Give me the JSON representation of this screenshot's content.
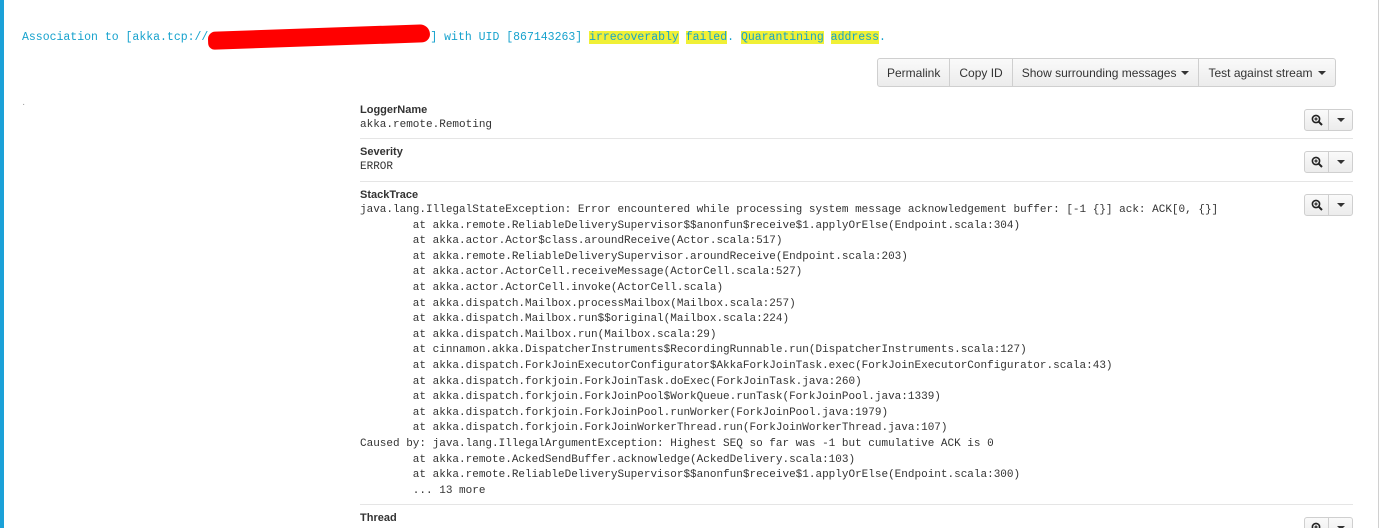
{
  "message": {
    "prefix": "Association to [akka.tcp://",
    "suffix_1": "] with UID [867143263] ",
    "hl_1": "irrecoverably",
    "hl_2": "failed",
    "dot_1": ". ",
    "hl_3": "Quarantining",
    "hl_4": "address",
    "dot_2": "."
  },
  "toolbar": {
    "permalink": "Permalink",
    "copy_id": "Copy ID",
    "show_surrounding": "Show surrounding messages",
    "test_against_stream": "Test against stream"
  },
  "left_marker": "·",
  "fields": [
    {
      "name": "LoggerName",
      "value": "akka.remote.Remoting"
    },
    {
      "name": "Severity",
      "value": "ERROR"
    },
    {
      "name": "StackTrace",
      "value": "java.lang.IllegalStateException: Error encountered while processing system message acknowledgement buffer: [-1 {}] ack: ACK[0, {}]\n        at akka.remote.ReliableDeliverySupervisor$$anonfun$receive$1.applyOrElse(Endpoint.scala:304)\n        at akka.actor.Actor$class.aroundReceive(Actor.scala:517)\n        at akka.remote.ReliableDeliverySupervisor.aroundReceive(Endpoint.scala:203)\n        at akka.actor.ActorCell.receiveMessage(ActorCell.scala:527)\n        at akka.actor.ActorCell.invoke(ActorCell.scala)\n        at akka.dispatch.Mailbox.processMailbox(Mailbox.scala:257)\n        at akka.dispatch.Mailbox.run$$original(Mailbox.scala:224)\n        at akka.dispatch.Mailbox.run(Mailbox.scala:29)\n        at cinnamon.akka.DispatcherInstruments$RecordingRunnable.run(DispatcherInstruments.scala:127)\n        at akka.dispatch.ForkJoinExecutorConfigurator$AkkaForkJoinTask.exec(ForkJoinExecutorConfigurator.scala:43)\n        at akka.dispatch.forkjoin.ForkJoinTask.doExec(ForkJoinTask.java:260)\n        at akka.dispatch.forkjoin.ForkJoinPool$WorkQueue.runTask(ForkJoinPool.java:1339)\n        at akka.dispatch.forkjoin.ForkJoinPool.runWorker(ForkJoinPool.java:1979)\n        at akka.dispatch.forkjoin.ForkJoinWorkerThread.run(ForkJoinWorkerThread.java:107)\nCaused by: java.lang.IllegalArgumentException: Highest SEQ so far was -1 but cumulative ACK is 0\n        at akka.remote.AckedSendBuffer.acknowledge(AckedDelivery.scala:103)\n        at akka.remote.ReliableDeliverySupervisor$$anonfun$receive$1.applyOrElse(Endpoint.scala:300)\n        ... 13 more"
    },
    {
      "name": "Thread",
      "value": ""
    }
  ],
  "icons": {
    "zoom": "magnifier-plus-icon",
    "dropdown": "caret-down-icon"
  },
  "colors": {
    "accent": "#1ba1d8",
    "message_text": "#16a2cd",
    "highlight": "#f0f036",
    "redaction": "#ff0000"
  }
}
